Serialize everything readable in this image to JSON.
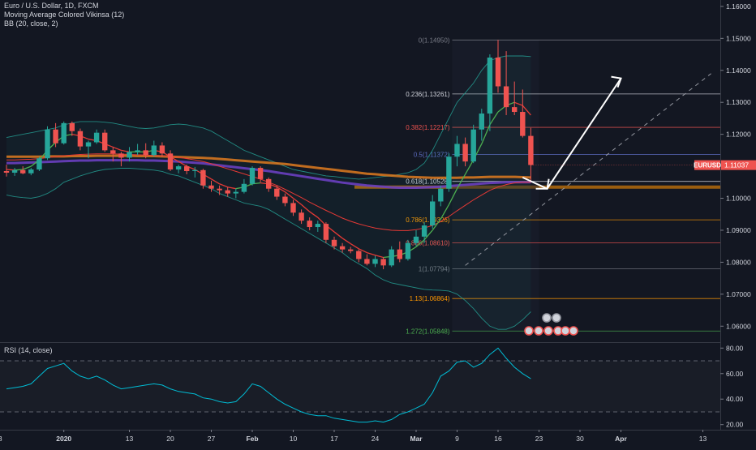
{
  "header": {
    "title": "Euro / U.S. Dollar, 1D, FXCM",
    "ma_label": "Moving Average Colored Vikinsa (12)",
    "bb_label": "BB (20, close, 2)"
  },
  "rsi_panel": {
    "label": "RSI (14, close)"
  },
  "colors": {
    "background": "#131722",
    "up_candle": "#26a69a",
    "down_candle": "#ef5350",
    "bb_band": "#26a69a",
    "ma_slow_orange": "#e07b1f",
    "ma_slow_purple": "#6a3fc0",
    "rsi_line": "#00bcd4",
    "price_badge": "#ef5350",
    "support_zone": "#b36a0c"
  },
  "chart_data": {
    "type": "candlestick",
    "symbol": "EURUSD",
    "last_price": "1.11037",
    "price_axis": {
      "ylim": [
        1.055,
        1.162
      ],
      "ticks": [
        "1.16000",
        "1.15000",
        "1.14000",
        "1.13000",
        "1.12000",
        "1.11000",
        "1.10000",
        "1.09000",
        "1.08000",
        "1.07000",
        "1.06000"
      ]
    },
    "time_axis": {
      "labels": [
        {
          "text": "23",
          "i": -1
        },
        {
          "text": "2020",
          "i": 7
        },
        {
          "text": "13",
          "i": 15
        },
        {
          "text": "20",
          "i": 20
        },
        {
          "text": "27",
          "i": 25
        },
        {
          "text": "Feb",
          "i": 30
        },
        {
          "text": "10",
          "i": 35
        },
        {
          "text": "17",
          "i": 40
        },
        {
          "text": "24",
          "i": 45
        },
        {
          "text": "Mar",
          "i": 50
        },
        {
          "text": "9",
          "i": 55
        },
        {
          "text": "16",
          "i": 60
        },
        {
          "text": "23",
          "i": 65
        },
        {
          "text": "30",
          "i": 70
        },
        {
          "text": "Apr",
          "i": 75
        },
        {
          "text": "13",
          "i": 85
        }
      ]
    },
    "candles": [
      [
        1.1085,
        1.1105,
        1.1068,
        1.108
      ],
      [
        1.108,
        1.1095,
        1.107,
        1.1088
      ],
      [
        1.1088,
        1.11,
        1.1075,
        1.1078
      ],
      [
        1.1078,
        1.1095,
        1.1072,
        1.109
      ],
      [
        1.109,
        1.113,
        1.1085,
        1.1125
      ],
      [
        1.1125,
        1.1225,
        1.112,
        1.1215
      ],
      [
        1.1215,
        1.1235,
        1.116,
        1.1172
      ],
      [
        1.1172,
        1.124,
        1.1168,
        1.1235
      ],
      [
        1.1235,
        1.124,
        1.1195,
        1.121
      ],
      [
        1.121,
        1.1218,
        1.115,
        1.1162
      ],
      [
        1.1162,
        1.118,
        1.1125,
        1.1175
      ],
      [
        1.1175,
        1.1215,
        1.117,
        1.1205
      ],
      [
        1.1205,
        1.1215,
        1.1145,
        1.115
      ],
      [
        1.115,
        1.116,
        1.1115,
        1.114
      ],
      [
        1.114,
        1.1145,
        1.11,
        1.1127
      ],
      [
        1.1127,
        1.116,
        1.1115,
        1.1145
      ],
      [
        1.1145,
        1.117,
        1.1135,
        1.115
      ],
      [
        1.115,
        1.1172,
        1.1125,
        1.1135
      ],
      [
        1.1135,
        1.118,
        1.113,
        1.1165
      ],
      [
        1.1165,
        1.1175,
        1.113,
        1.114
      ],
      [
        1.114,
        1.115,
        1.1085,
        1.109
      ],
      [
        1.109,
        1.1105,
        1.1078,
        1.11
      ],
      [
        1.11,
        1.1105,
        1.1075,
        1.1085
      ],
      [
        1.1085,
        1.1098,
        1.1065,
        1.1088
      ],
      [
        1.1088,
        1.1092,
        1.103,
        1.104
      ],
      [
        1.104,
        1.1055,
        1.102,
        1.103
      ],
      [
        1.103,
        1.104,
        1.101,
        1.1025
      ],
      [
        1.1025,
        1.1035,
        1.1005,
        1.1015
      ],
      [
        1.1015,
        1.103,
        1.1,
        1.102
      ],
      [
        1.102,
        1.106,
        1.1015,
        1.1045
      ],
      [
        1.1045,
        1.11,
        1.104,
        1.1095
      ],
      [
        1.1095,
        1.11,
        1.105,
        1.106
      ],
      [
        1.106,
        1.1065,
        1.102,
        1.103
      ],
      [
        1.103,
        1.104,
        1.0995,
        1.1005
      ],
      [
        1.1005,
        1.1015,
        1.0975,
        1.0985
      ],
      [
        1.0985,
        1.0995,
        1.0945,
        1.0955
      ],
      [
        1.0955,
        1.0965,
        1.092,
        1.093
      ],
      [
        1.093,
        1.094,
        1.09,
        1.091
      ],
      [
        1.091,
        1.093,
        1.0895,
        1.092
      ],
      [
        1.092,
        1.0925,
        1.086,
        1.087
      ],
      [
        1.087,
        1.088,
        1.084,
        1.085
      ],
      [
        1.085,
        1.086,
        1.083,
        1.084
      ],
      [
        1.084,
        1.0848,
        1.0828,
        1.0835
      ],
      [
        1.0835,
        1.084,
        1.08,
        1.081
      ],
      [
        1.081,
        1.0825,
        1.079,
        1.0795
      ],
      [
        1.0795,
        1.082,
        1.0785,
        1.081
      ],
      [
        1.081,
        1.0815,
        1.0778,
        1.079
      ],
      [
        1.079,
        1.085,
        1.0785,
        1.084
      ],
      [
        1.084,
        1.0865,
        1.08,
        1.081
      ],
      [
        1.081,
        1.087,
        1.0805,
        1.086
      ],
      [
        1.086,
        1.09,
        1.085,
        1.088
      ],
      [
        1.088,
        1.0925,
        1.086,
        1.0915
      ],
      [
        1.0915,
        1.101,
        1.0905,
        1.099
      ],
      [
        1.099,
        1.104,
        1.0975,
        1.103
      ],
      [
        1.103,
        1.114,
        1.102,
        1.113
      ],
      [
        1.113,
        1.1195,
        1.11,
        1.117
      ],
      [
        1.117,
        1.119,
        1.11,
        1.1115
      ],
      [
        1.1115,
        1.123,
        1.111,
        1.1215
      ],
      [
        1.1215,
        1.128,
        1.118,
        1.1265
      ],
      [
        1.1265,
        1.145,
        1.121,
        1.144
      ],
      [
        1.144,
        1.1495,
        1.133,
        1.135
      ],
      [
        1.135,
        1.146,
        1.126,
        1.1285
      ],
      [
        1.1285,
        1.1365,
        1.126,
        1.127
      ],
      [
        1.127,
        1.134,
        1.119,
        1.1195
      ],
      [
        1.1195,
        1.122,
        1.1052,
        1.1104
      ]
    ],
    "ma12": [
      1.109,
      1.1088,
      1.109,
      1.11,
      1.112,
      1.115,
      1.1175,
      1.1195,
      1.12,
      1.1195,
      1.1185,
      1.118,
      1.117,
      1.116,
      1.115,
      1.1145,
      1.1145,
      1.1145,
      1.115,
      1.1145,
      1.113,
      1.1115,
      1.11,
      1.109,
      1.1075,
      1.106,
      1.1045,
      1.1035,
      1.103,
      1.1035,
      1.1045,
      1.1048,
      1.1045,
      1.1035,
      1.102,
      1.1,
      1.098,
      1.0958,
      1.094,
      1.0915,
      1.0895,
      1.0875,
      1.0858,
      1.0842,
      1.083,
      1.0822,
      1.0815,
      1.0818,
      1.0822,
      1.0832,
      1.0848,
      1.087,
      1.09,
      1.0935,
      1.098,
      1.103,
      1.1075,
      1.112,
      1.117,
      1.123,
      1.127,
      1.129,
      1.13,
      1.129,
      1.126
    ],
    "bb_upper": [
      1.119,
      1.1195,
      1.12,
      1.1205,
      1.121,
      1.1215,
      1.122,
      1.123,
      1.1235,
      1.124,
      1.124,
      1.124,
      1.1238,
      1.1235,
      1.123,
      1.1225,
      1.122,
      1.1218,
      1.122,
      1.1225,
      1.123,
      1.1232,
      1.123,
      1.1225,
      1.122,
      1.121,
      1.1195,
      1.118,
      1.1165,
      1.115,
      1.114,
      1.113,
      1.112,
      1.111,
      1.11,
      1.109,
      1.1085,
      1.108,
      1.1075,
      1.107,
      1.1068,
      1.1065,
      1.1062,
      1.106,
      1.1062,
      1.1065,
      1.1068,
      1.107,
      1.1075,
      1.108,
      1.109,
      1.111,
      1.115,
      1.12,
      1.125,
      1.13,
      1.133,
      1.136,
      1.14,
      1.143,
      1.144,
      1.1445,
      1.1445,
      1.1445,
      1.1443
    ],
    "bb_lower": [
      1.101,
      1.1005,
      1.1002,
      1.1,
      1.1005,
      1.1015,
      1.103,
      1.105,
      1.106,
      1.107,
      1.1078,
      1.1085,
      1.109,
      1.1092,
      1.1094,
      1.1094,
      1.1092,
      1.109,
      1.1088,
      1.1084,
      1.1075,
      1.107,
      1.106,
      1.105,
      1.104,
      1.103,
      1.1015,
      1.1005,
      1.0995,
      1.0985,
      1.098,
      1.0975,
      1.0965,
      1.095,
      1.0935,
      1.092,
      1.0905,
      1.089,
      1.0875,
      1.086,
      1.0845,
      1.083,
      1.081,
      1.0795,
      1.078,
      1.076,
      1.0745,
      1.0735,
      1.073,
      1.0725,
      1.072,
      1.0715,
      1.0713,
      1.0712,
      1.071,
      1.07,
      1.068,
      1.0655,
      1.0625,
      1.06,
      1.059,
      1.059,
      1.06,
      1.062,
      1.0645
    ],
    "ma_slow_orange": [
      1.113,
      1.113,
      1.113,
      1.113,
      1.113,
      1.1131,
      1.1131,
      1.1131,
      1.1132,
      1.1132,
      1.1132,
      1.1133,
      1.1133,
      1.1133,
      1.1133,
      1.1133,
      1.1132,
      1.1132,
      1.1132,
      1.1131,
      1.113,
      1.1129,
      1.1128,
      1.1127,
      1.1126,
      1.1125,
      1.1123,
      1.1121,
      1.1119,
      1.1117,
      1.1115,
      1.1113,
      1.1111,
      1.1109,
      1.1107,
      1.1104,
      1.1101,
      1.1098,
      1.1095,
      1.1092,
      1.1089,
      1.1086,
      1.1083,
      1.108,
      1.1077,
      1.1075,
      1.1073,
      1.1071,
      1.1069,
      1.1067,
      1.1066,
      1.1065,
      1.1064,
      1.1064,
      1.1064,
      1.1064,
      1.1065,
      1.1065,
      1.1066,
      1.1067,
      1.1067,
      1.1067,
      1.1067,
      1.1066,
      1.1065
    ],
    "ma_slow_purple": [
      1.111,
      1.111,
      1.1111,
      1.1112,
      1.1113,
      1.1114,
      1.1115,
      1.1116,
      1.1117,
      1.1118,
      1.1118,
      1.1119,
      1.1119,
      1.1119,
      1.1119,
      1.1119,
      1.1119,
      1.1118,
      1.1118,
      1.1117,
      1.1116,
      1.1115,
      1.1113,
      1.1111,
      1.1109,
      1.1106,
      1.1103,
      1.11,
      1.1097,
      1.1094,
      1.1091,
      1.1088,
      1.1085,
      1.1081,
      1.1077,
      1.1073,
      1.1069,
      1.1065,
      1.1061,
      1.1057,
      1.1053,
      1.1049,
      1.1046,
      1.1043,
      1.104,
      1.1038,
      1.1036,
      1.1034,
      1.1033,
      1.1033,
      1.1033,
      1.1034,
      1.1035,
      1.1036,
      1.1038,
      1.104,
      1.1042,
      1.1044,
      1.1046,
      1.1048,
      1.1049,
      1.105,
      1.105,
      1.105,
      1.105
    ],
    "ma_red": [
      1.112,
      1.112,
      1.1121,
      1.1122,
      1.1124,
      1.1127,
      1.113,
      1.1133,
      1.1135,
      1.1137,
      1.1138,
      1.1139,
      1.1139,
      1.1139,
      1.1138,
      1.1137,
      1.1136,
      1.1135,
      1.1134,
      1.1133,
      1.1131,
      1.1128,
      1.1124,
      1.112,
      1.1115,
      1.1108,
      1.11,
      1.1092,
      1.1084,
      1.1076,
      1.1068,
      1.106,
      1.105,
      1.104,
      1.1028,
      1.1015,
      1.1002,
      1.0988,
      1.0975,
      1.0962,
      1.095,
      1.0938,
      1.0928,
      1.092,
      1.0913,
      1.0907,
      1.0903,
      1.09,
      1.0899,
      1.0899,
      1.0902,
      1.0907,
      1.0915,
      1.0927,
      1.0943,
      1.0961,
      1.0978,
      1.0995,
      1.101,
      1.1025,
      1.1035,
      1.1043,
      1.1048,
      1.105,
      1.105
    ],
    "fibonacci": [
      {
        "level": "0",
        "price": "1.14950",
        "value": 1.1495,
        "color": "#787b86"
      },
      {
        "level": "0.236",
        "price": "1.13261",
        "value": 1.13261,
        "color": "#d1d4dc"
      },
      {
        "level": "0.382",
        "price": "1.12217",
        "value": 1.12217,
        "color": "#ef5350"
      },
      {
        "level": "0.5",
        "price": "1.11372",
        "value": 1.11372,
        "color": "#5c6bc0"
      },
      {
        "level": "0.618",
        "price": "1.10528",
        "value": 1.10528,
        "color": "#d1d4dc"
      },
      {
        "level": "0.786",
        "price": "1.09326",
        "value": 1.09326,
        "color": "#ff9800"
      },
      {
        "level": "0.886",
        "price": "1.08610",
        "value": 1.0861,
        "color": "#ef5350"
      },
      {
        "level": "1",
        "price": "1.07794",
        "value": 1.07794,
        "color": "#787b86"
      },
      {
        "level": "1.13",
        "price": "1.06864",
        "value": 1.06864,
        "color": "#ff9800"
      },
      {
        "level": "1.272",
        "price": "1.05848",
        "value": 1.05848,
        "color": "#4caf50"
      }
    ],
    "support_zone": [
      1.103,
      1.104
    ],
    "projection_arrow": {
      "start": [
        63,
        1.1065
      ],
      "mid": [
        66,
        1.103
      ],
      "end": [
        75,
        1.1375
      ]
    },
    "trendline": {
      "start": [
        56,
        1.079
      ],
      "end": [
        86,
        1.139
      ]
    },
    "rsi": {
      "ylim": [
        16,
        84
      ],
      "levels": [
        70,
        30
      ],
      "ticks": [
        "80.00",
        "60.00",
        "40.00",
        "20.00"
      ],
      "values": [
        48,
        49,
        50,
        52,
        58,
        64,
        66,
        68,
        62,
        58,
        56,
        58,
        55,
        51,
        48,
        49,
        50,
        51,
        52,
        51,
        48,
        46,
        45,
        44,
        41,
        40,
        38,
        37,
        38,
        44,
        52,
        50,
        45,
        40,
        36,
        33,
        30,
        28,
        27,
        27,
        25,
        24,
        23,
        22,
        22,
        23,
        22,
        24,
        28,
        30,
        33,
        36,
        45,
        58,
        62,
        69,
        70,
        65,
        68,
        75,
        80,
        72,
        65,
        60,
        56
      ]
    }
  }
}
